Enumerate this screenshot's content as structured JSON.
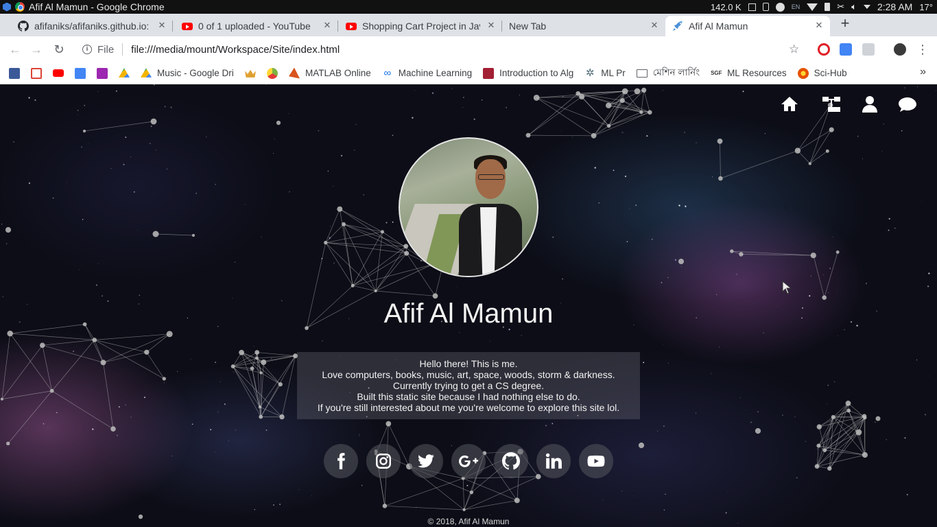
{
  "system": {
    "window_title": "Afif Al Mamun - Google Chrome",
    "net_speed": "142.0 K",
    "lang": "EN",
    "time": "2:28 AM",
    "temperature": "17°"
  },
  "tabs": [
    {
      "label": "afifaniks/afifaniks.github.io: P",
      "icon": "github-icon"
    },
    {
      "label": "0 of 1 uploaded - YouTube",
      "icon": "youtube-icon"
    },
    {
      "label": "Shopping Cart Project in Java",
      "icon": "youtube-icon"
    },
    {
      "label": "New Tab",
      "icon": ""
    },
    {
      "label": "Afif Al Mamun",
      "icon": "rocket-icon",
      "active": true
    }
  ],
  "address": {
    "scheme_label": "File",
    "url": "file:///media/mount/Workspace/Site/index.html"
  },
  "bookmarks": [
    {
      "label": "",
      "icon": "facebook-icon",
      "color": "#3b5998"
    },
    {
      "label": "",
      "icon": "gmail-icon",
      "color": "#db4437"
    },
    {
      "label": "",
      "icon": "youtube-icon",
      "color": "#ff0000"
    },
    {
      "label": "",
      "icon": "translate-icon",
      "color": "#4285f4"
    },
    {
      "label": "",
      "icon": "profile-icon",
      "color": "#9c27b0"
    },
    {
      "label": "",
      "icon": "drive-icon",
      "color": "#34a853"
    },
    {
      "label": "Music - Google Driv",
      "icon": "drive-icon",
      "color": "#f4b400"
    },
    {
      "label": "",
      "icon": "crown-icon",
      "color": "#e0a030"
    },
    {
      "label": "",
      "icon": "hub-icon",
      "color": "#7cb342"
    },
    {
      "label": "MATLAB Online",
      "icon": "matlab-icon",
      "color": "#d9541e"
    },
    {
      "label": "Machine Learning",
      "icon": "infinity-icon",
      "color": "#1a73e8"
    },
    {
      "label": "Introduction to Alg",
      "icon": "mit-icon",
      "color": "#a31f34"
    },
    {
      "label": "ML Pr",
      "icon": "gear-icon",
      "color": "#546e7a"
    },
    {
      "label": "মেশিন লার্নিং",
      "icon": "book-icon",
      "color": "#5f6368"
    },
    {
      "label": "ML Resources",
      "icon": "sgf-icon",
      "color": "#333333"
    },
    {
      "label": "Sci-Hub",
      "icon": "scihub-icon",
      "color": "#e65100"
    }
  ],
  "profile": {
    "name": "Afif Al Mamun",
    "bio": [
      "Hello there! This is me.",
      "Love computers, books, music, art, space, woods, storm & darkness.",
      "Currently trying to get a CS degree.",
      "Built this static site because I had nothing else to do.",
      "If you're still interested about me you're welcome to explore this site lol."
    ],
    "footer": "© 2018, Afif Al Mamun"
  },
  "social": [
    "facebook-icon",
    "instagram-icon",
    "twitter-icon",
    "google-plus-icon",
    "github-icon",
    "linkedin-icon",
    "youtube-icon"
  ],
  "colors": {
    "background": "#0c0d16",
    "text": "#f4f4f4",
    "social_bg": "#55585f"
  }
}
